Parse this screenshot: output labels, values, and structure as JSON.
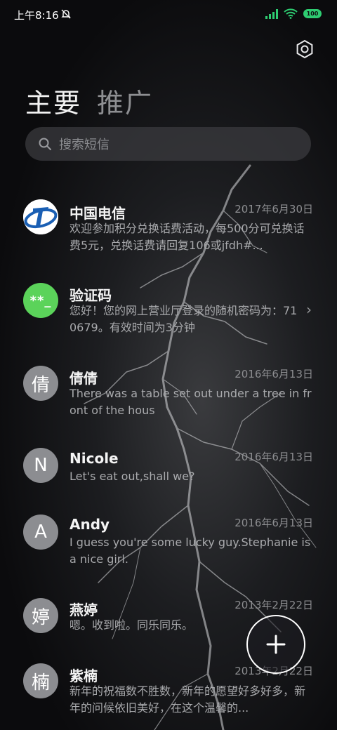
{
  "status_bar": {
    "time": "上午8:16",
    "battery": "100"
  },
  "tabs": [
    {
      "label": "主要"
    },
    {
      "label": "推广"
    }
  ],
  "search": {
    "placeholder": "搜索短信"
  },
  "conversations": [
    {
      "name": "中国电信",
      "date": "2017年6月30日",
      "preview": "欢迎参加积分兑换话费活动，每500分可兑换话费5元，兑换话费请回复106或jfdh#..."
    },
    {
      "name": "验证码",
      "avatar_text": "**_",
      "date": "",
      "preview": "您好！您的网上营业厅登录的随机密码为：710679。有效时间为3分钟"
    },
    {
      "name": "倩倩",
      "avatar_text": "倩",
      "date": "2016年6月13日",
      "preview": "There was a table set out under a tree in front of the hous"
    },
    {
      "name": "Nicole",
      "avatar_text": "N",
      "date": "2016年6月13日",
      "preview": "Let's eat out,shall we?"
    },
    {
      "name": "Andy",
      "avatar_text": "A",
      "date": "2016年6月13日",
      "preview": "I guess you're some lucky guy.Stephanie is a nice girl."
    },
    {
      "name": "燕婷",
      "avatar_text": "婷",
      "date": "2013年2月22日",
      "preview": "嗯。收到啦。同乐同乐。"
    },
    {
      "name": "紫楠",
      "avatar_text": "楠",
      "date": "2013年2月22日",
      "preview": "新年的祝福数不胜数，新年的愿望好多好多，新年的问候依旧美好，在这个温馨的..."
    }
  ],
  "colors": {
    "code_avatar": "#5bd35a",
    "letter_avatar": "#8c8d91",
    "battery": "#2ecc71",
    "telecom_blue": "#1a5fb4"
  },
  "icons": {
    "settings": "hexagon-gear-icon",
    "search": "search-icon",
    "compose": "plus-icon",
    "chevron": "chevron-right-icon"
  }
}
